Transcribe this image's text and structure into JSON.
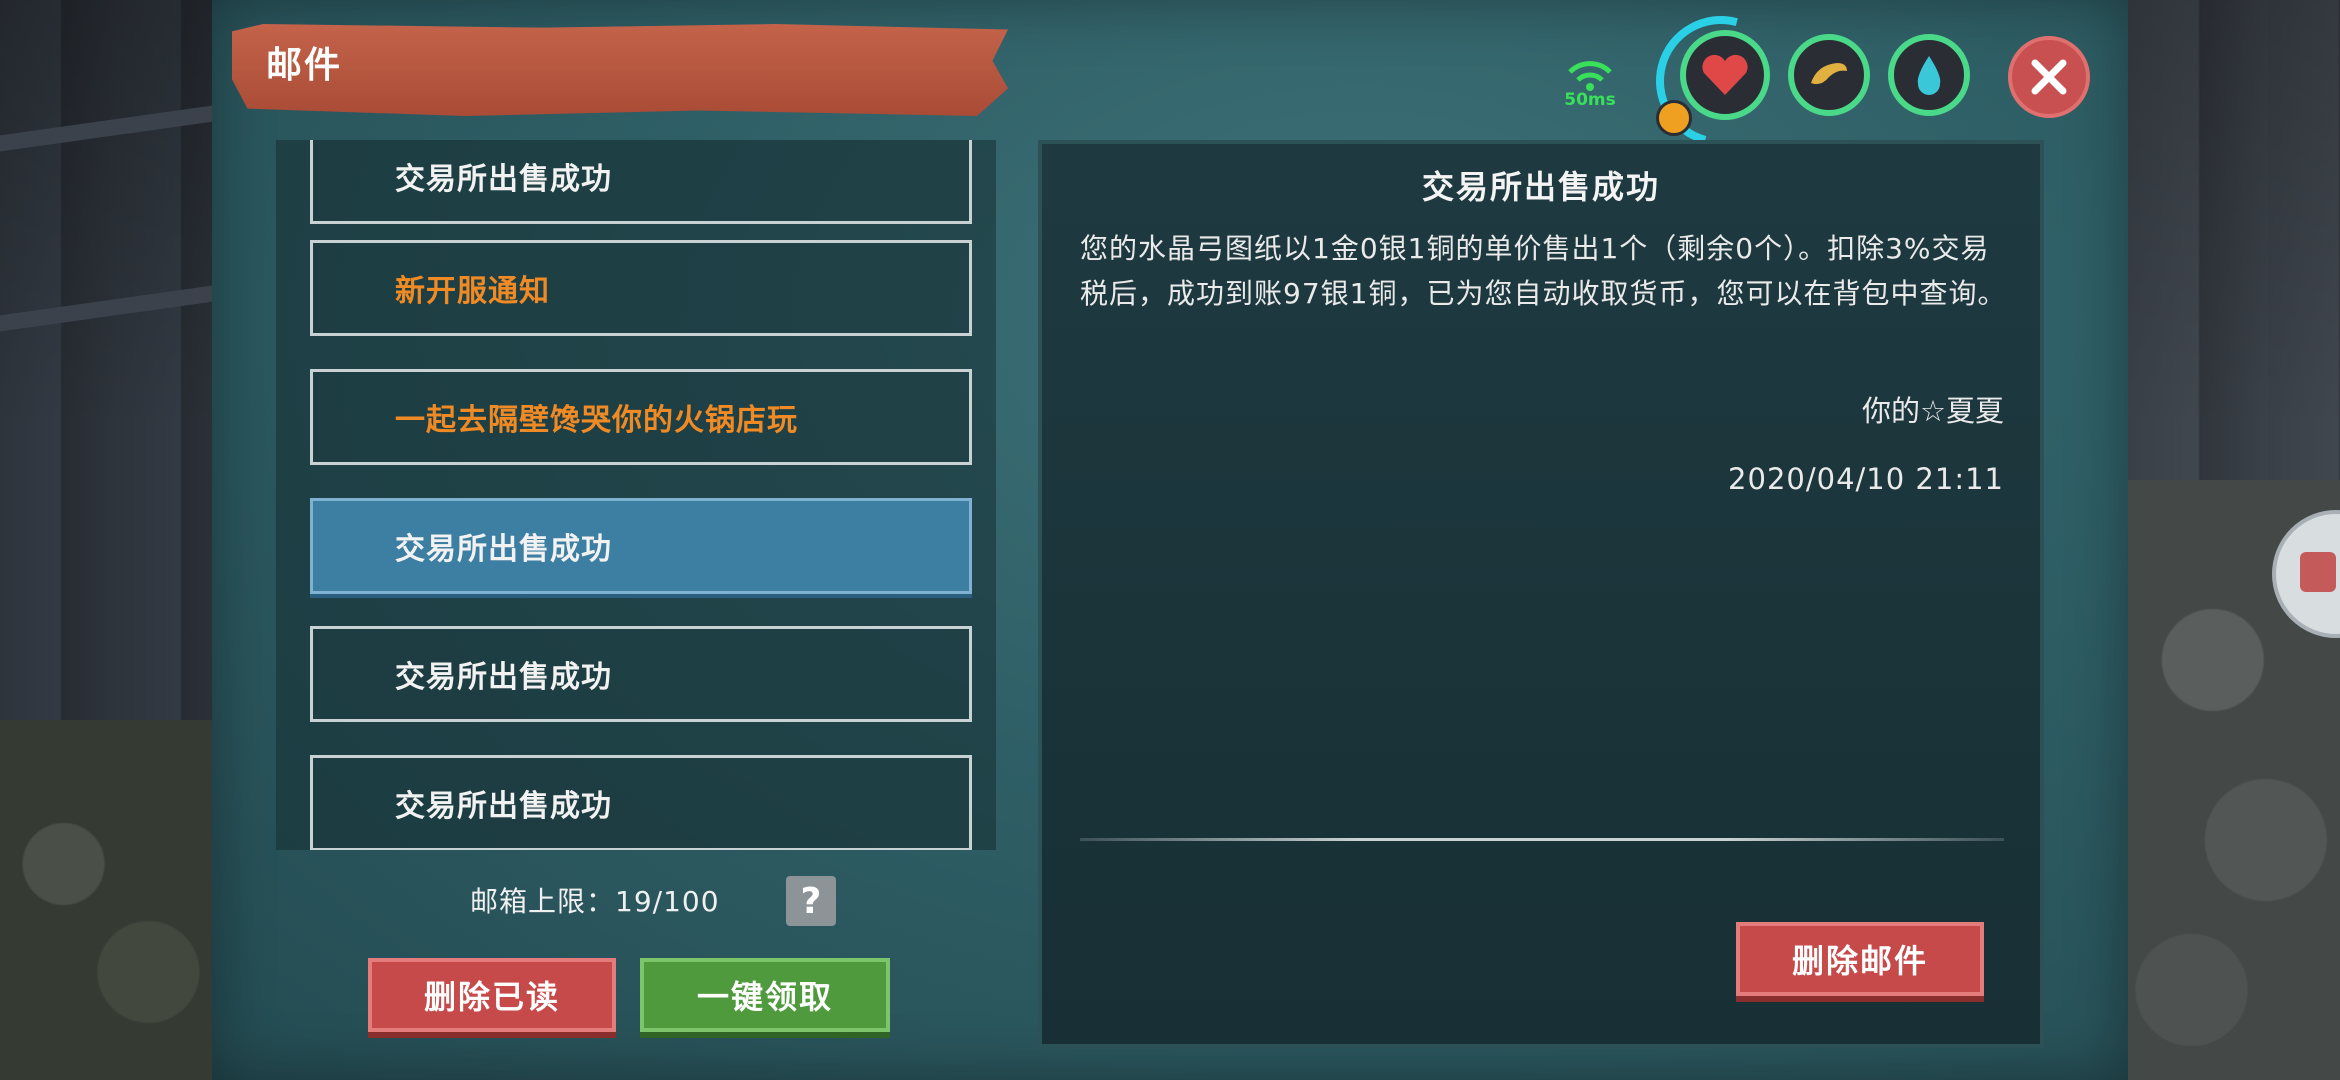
{
  "window": {
    "title": "邮件"
  },
  "status": {
    "ping": "50ms"
  },
  "mail_list": [
    {
      "label": "交易所出售成功",
      "state": "read"
    },
    {
      "label": "新开服通知",
      "state": "unread"
    },
    {
      "label": "一起去隔壁馋哭你的火锅店玩",
      "state": "unread"
    },
    {
      "label": "交易所出售成功",
      "state": "selected"
    },
    {
      "label": "交易所出售成功",
      "state": "read"
    },
    {
      "label": "交易所出售成功",
      "state": "read"
    }
  ],
  "capacity": {
    "text": "邮箱上限：19/100"
  },
  "buttons": {
    "help": "?",
    "delete_read": "删除已读",
    "claim_all": "一键领取",
    "delete_mail": "删除邮件"
  },
  "detail": {
    "title": "交易所出售成功",
    "body": "您的水晶弓图纸以1金0银1铜的单价售出1个（剩余0个）。扣除3%交易税后，成功到账97银1铜，已为您自动收取货币，您可以在背包中查询。",
    "sender": "你的☆夏夏",
    "date": "2020/04/10 21:11"
  },
  "colors": {
    "unread": "#f08a24",
    "selected": "#3d7ea3",
    "ping": "#39e05a",
    "red_button": "#c64a4a",
    "green_button": "#4e9a3c"
  },
  "icons": [
    "wifi-signal-icon",
    "heart-icon",
    "food-icon",
    "water-drop-icon",
    "shield-icon",
    "close-icon",
    "help-icon"
  ]
}
